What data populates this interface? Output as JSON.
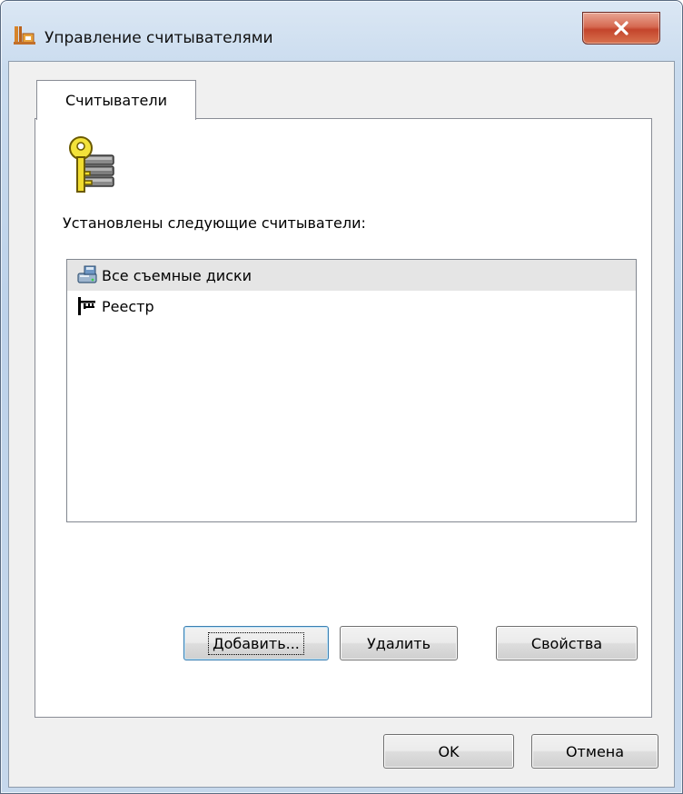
{
  "window": {
    "title": "Управление считывателями",
    "close_icon": "close-x-icon",
    "app_icon": "app-icon"
  },
  "tabs": [
    {
      "label": "Считыватели",
      "selected": true
    }
  ],
  "panel": {
    "icon": "key-server-icon",
    "label": "Установлены следующие считыватели:",
    "readers": [
      {
        "label": "Все съемные диски",
        "icon": "removable-disk-icon",
        "selected": true
      },
      {
        "label": "Реестр",
        "icon": "registry-icon",
        "selected": false
      }
    ]
  },
  "buttons": {
    "add": "Добавить...",
    "remove": "Удалить",
    "properties": "Свойства",
    "ok": "OK",
    "cancel": "Отмена"
  },
  "colors": {
    "close_button": "#c4452c",
    "selection": "#e5e5e5",
    "dialog_bg": "#f0f0f0"
  }
}
